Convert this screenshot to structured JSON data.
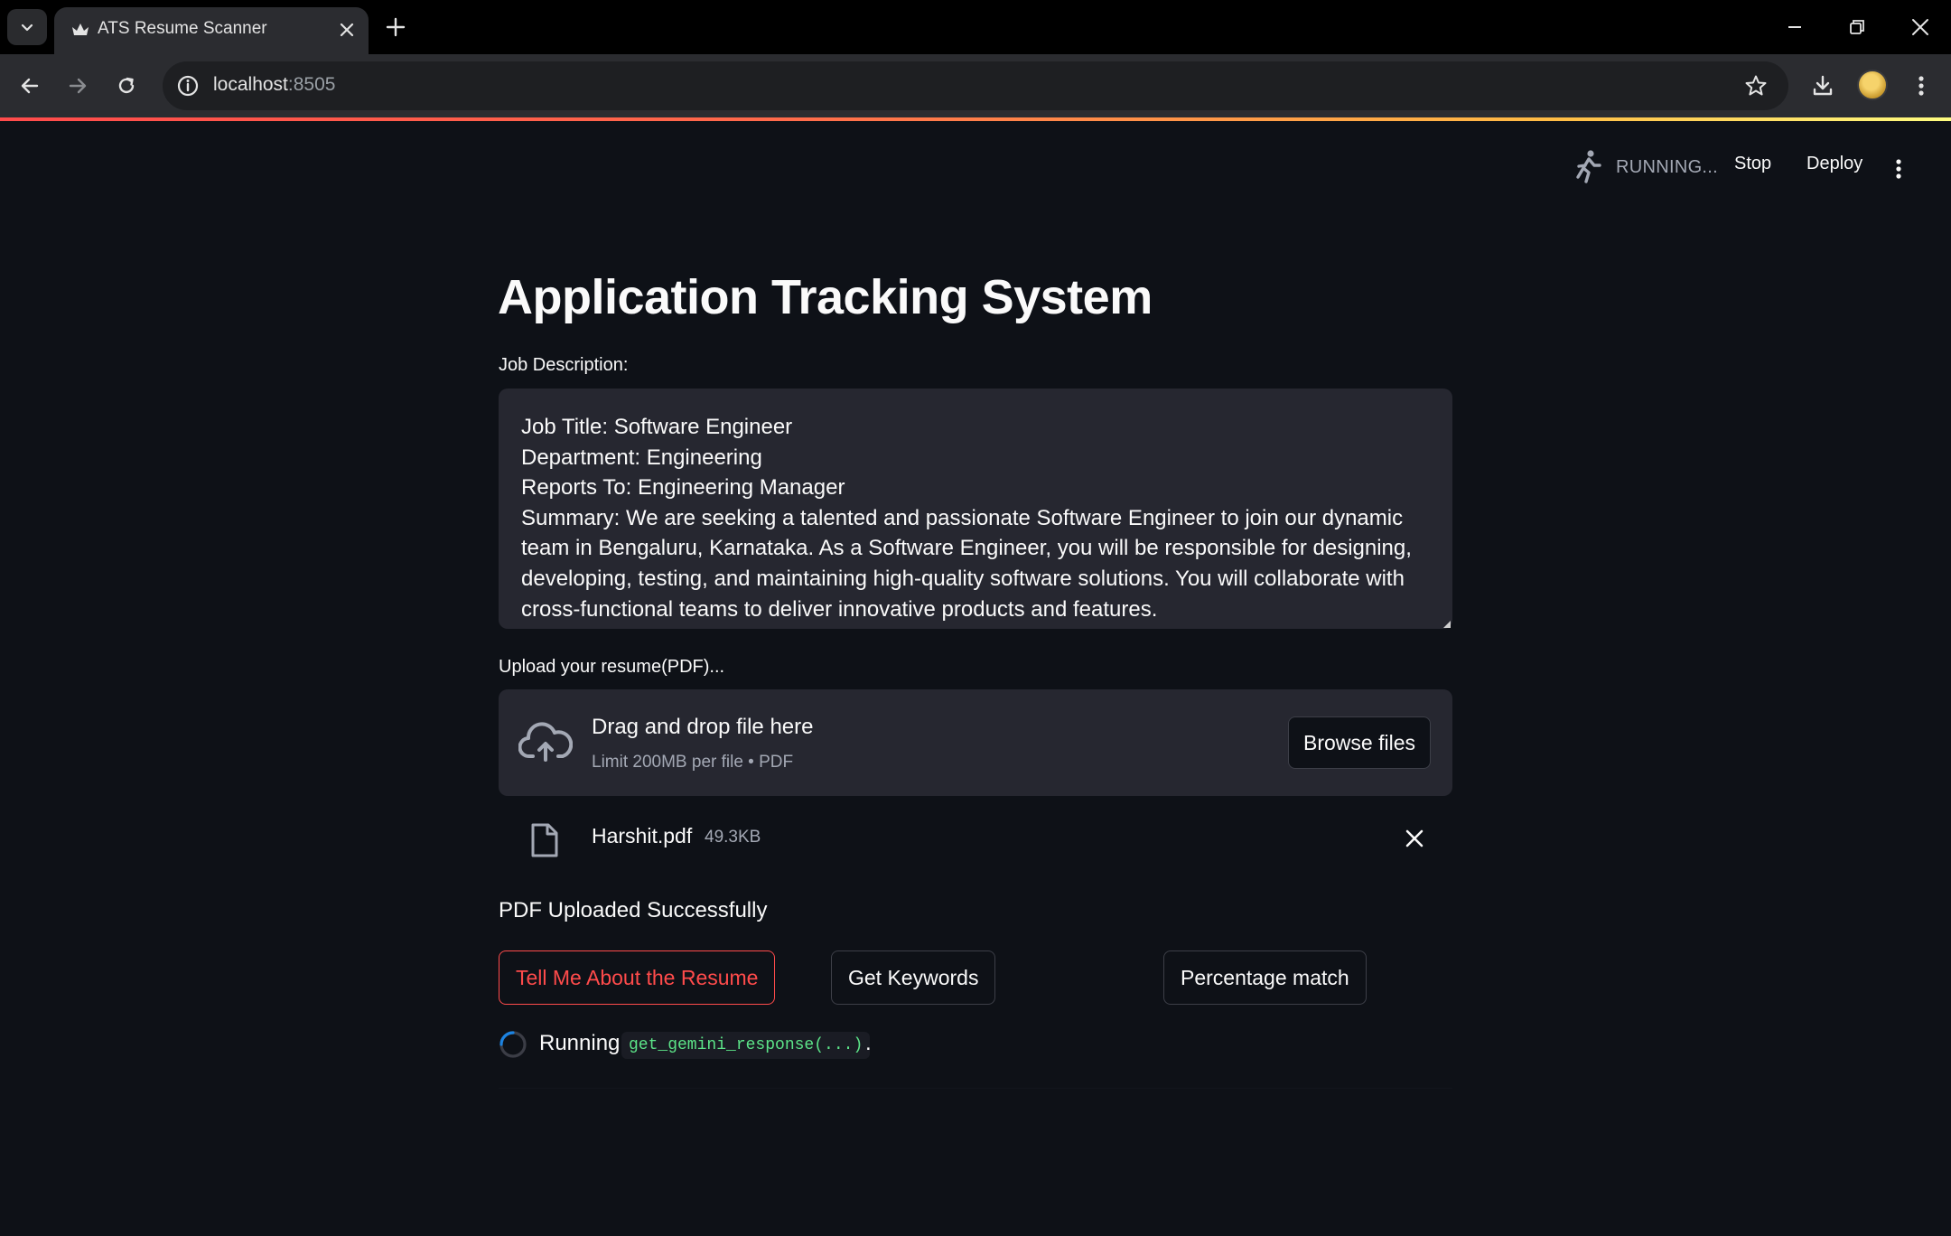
{
  "browser": {
    "tab_title": "ATS Resume Scanner",
    "url_host": "localhost",
    "url_port": ":8505"
  },
  "header": {
    "status_label": "RUNNING...",
    "stop_label": "Stop",
    "deploy_label": "Deploy"
  },
  "main": {
    "title": "Application Tracking System",
    "job_description_label": "Job Description:",
    "job_description_value": "Job Title: Software Engineer\nDepartment: Engineering\nReports To: Engineering Manager\nSummary: We are seeking a talented and passionate Software Engineer to join our dynamic team in Bengaluru, Karnataka. As a Software Engineer, you will be responsible for designing, developing, testing, and maintaining high-quality software solutions. You will collaborate with cross-functional teams to deliver innovative products and features.",
    "upload_label": "Upload your resume(PDF)...",
    "uploader": {
      "drop_title": "Drag and drop file here",
      "limit_text": "Limit 200MB per file • PDF",
      "browse_label": "Browse files"
    },
    "uploaded_file": {
      "name": "Harshit.pdf",
      "size": "49.3KB"
    },
    "status_message": "PDF Uploaded Successfully",
    "buttons": {
      "tell_me": "Tell Me About the Resume",
      "keywords": "Get Keywords",
      "percentage": "Percentage match"
    },
    "running": {
      "label": "Running",
      "code": "get_gemini_response(...)",
      "suffix": "."
    }
  },
  "colors": {
    "accent": "#ff4b4b",
    "background": "#0e1117",
    "input_bg": "#262730",
    "code_text": "#5ce488"
  }
}
